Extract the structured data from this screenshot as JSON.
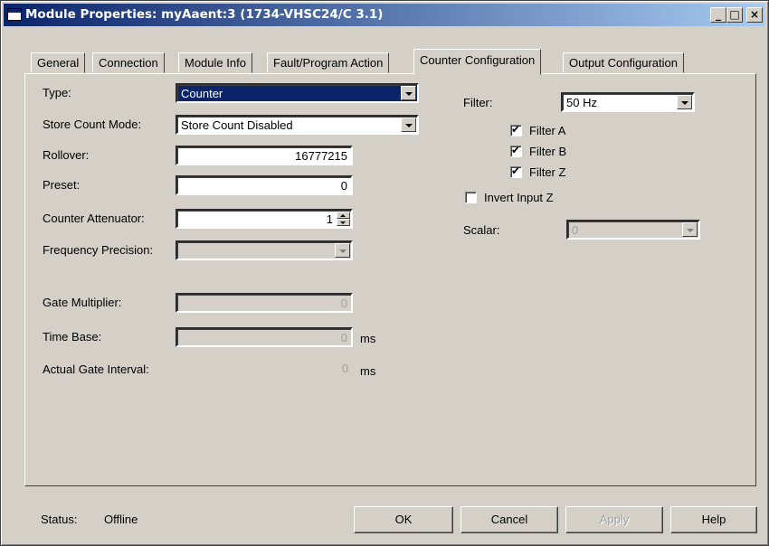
{
  "window": {
    "title": "Module Properties: myAaent:3 (1734-VHSC24/C 3.1)",
    "minimize": "_",
    "maximize": "□",
    "close": "×"
  },
  "tabs": [
    {
      "label": "General"
    },
    {
      "label": "Connection"
    },
    {
      "label": "Module Info"
    },
    {
      "label": "Fault/Program Action"
    },
    {
      "label": "Counter Configuration",
      "active": true
    },
    {
      "label": "Output Configuration"
    }
  ],
  "left": {
    "type_label": "Type:",
    "type_value": "Counter",
    "store_label": "Store Count Mode:",
    "store_value": "Store Count Disabled",
    "rollover_label": "Rollover:",
    "rollover_value": "16777215",
    "preset_label": "Preset:",
    "preset_value": "0",
    "attenuator_label": "Counter Attenuator:",
    "attenuator_value": "1",
    "freq_label": "Frequency Precision:",
    "freq_value": "",
    "gate_label": "Gate Multiplier:",
    "gate_value": "0",
    "timebase_label": "Time Base:",
    "timebase_value": "0",
    "timebase_unit": "ms",
    "actual_label": "Actual Gate Interval:",
    "actual_value": "0",
    "actual_unit": "ms"
  },
  "right": {
    "filter_label": "Filter:",
    "filter_value": "50 Hz",
    "filter_a": "Filter A",
    "filter_b": "Filter B",
    "filter_z": "Filter Z",
    "invert_z": "Invert Input Z",
    "scalar_label": "Scalar:",
    "scalar_value": "0",
    "filter_a_checked": true,
    "filter_b_checked": true,
    "filter_z_checked": true,
    "invert_z_checked": false
  },
  "footer": {
    "status_label": "Status:",
    "status_value": "Offline",
    "ok": "OK",
    "cancel": "Cancel",
    "apply": "Apply",
    "help": "Help"
  }
}
